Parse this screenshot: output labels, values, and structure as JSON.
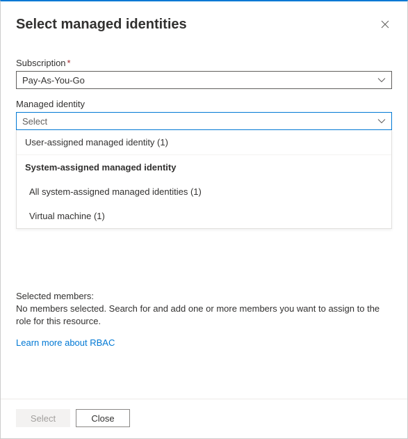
{
  "header": {
    "title": "Select managed identities"
  },
  "fields": {
    "subscription": {
      "label": "Subscription",
      "required_marker": "*",
      "value": "Pay-As-You-Go"
    },
    "managed_identity": {
      "label": "Managed identity",
      "placeholder": "Select"
    }
  },
  "dropdown": {
    "user_assigned": "User-assigned managed identity (1)",
    "system_header": "System-assigned managed identity",
    "all_system": "All system-assigned managed identities (1)",
    "virtual_machine": "Virtual machine (1)"
  },
  "selected": {
    "title": "Selected members:",
    "empty_text": "No members selected. Search for and add one or more members you want to assign to the role for this resource."
  },
  "links": {
    "learn_more": "Learn more about RBAC"
  },
  "footer": {
    "select": "Select",
    "close": "Close"
  }
}
